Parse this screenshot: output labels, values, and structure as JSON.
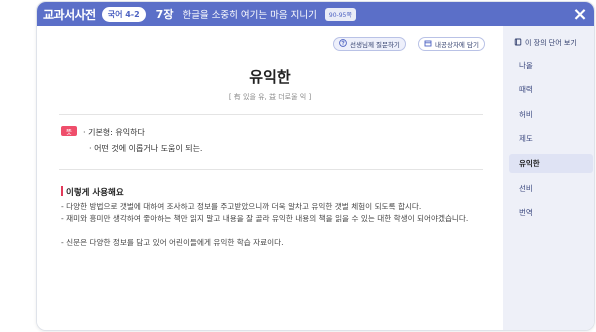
{
  "header": {
    "app_title": "교과서사전",
    "grade_badge": "국어 4-2",
    "chapter_num": "7장",
    "chapter_title": "한글을 소중히 여기는 마음 지니기",
    "page_badge": "90-95쪽",
    "close_icon": "×"
  },
  "actions": {
    "ask_label": "선생님께 질문하기",
    "ask_icon": "question-icon",
    "save_label": "내공상자에 담기",
    "save_icon": "box-icon"
  },
  "word": {
    "title": "유익한",
    "hanja": "[ 有 있을 유, 益 더로울 익 ]"
  },
  "meaning": {
    "badge": "뜻",
    "base_form": "· 기본형: 유익하다",
    "definition": "· 어떤 것에 이롭거나 도움이 되는."
  },
  "usage": {
    "title": "이렇게 사용해요",
    "lines": [
      "- 다양한 방법으로 갯벌에 대하여 조사하고 정보를 주고받았으니까 더욱 알차고 유익한 갯벌 체험이 되도록 합시다.",
      "- 재미와 흥미만 생각하여 좋아하는 책만 읽지 말고 내용을 잘 골라 유익한 내용의 책을 읽을 수 있는 대한 학생이 되어야겠습니다.",
      "- 신문은 다양한 정보를 담고 있어 어린이들에게 유익한 학습 자료이다."
    ]
  },
  "sidebar": {
    "top_label": "이 장의 단어 보기",
    "top_icon": "book-icon",
    "items": [
      {
        "label": "나올",
        "active": false
      },
      {
        "label": "때력",
        "active": false
      },
      {
        "label": "허비",
        "active": false
      },
      {
        "label": "제도",
        "active": false
      },
      {
        "label": "유익한",
        "active": true
      },
      {
        "label": "선비",
        "active": false
      },
      {
        "label": "번역",
        "active": false
      }
    ]
  },
  "colors": {
    "header": "#5b6fc8",
    "accent_red": "#ef4e6b",
    "sidebar_bg": "#eef0f8"
  }
}
